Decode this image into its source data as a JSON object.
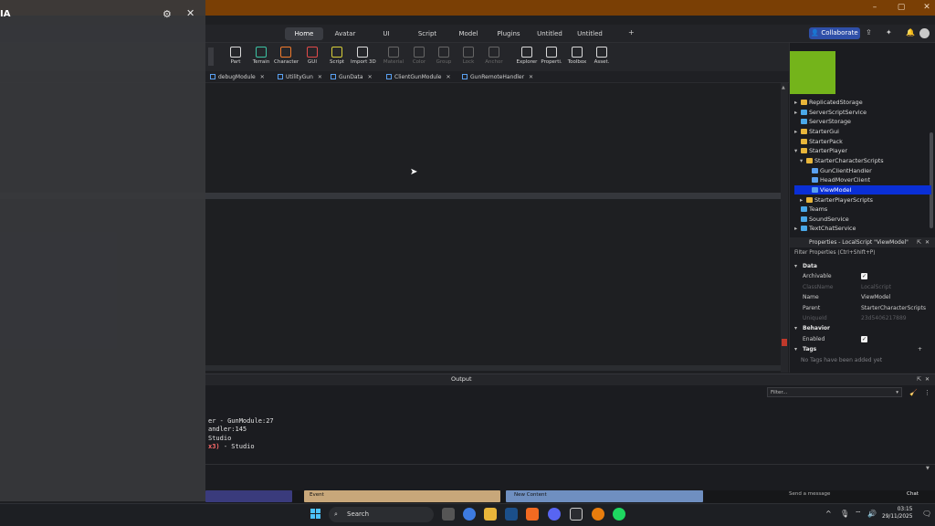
{
  "overlay": {
    "title": "IA",
    "settings_icon": "gear-icon",
    "close_icon": "close-icon"
  },
  "window": {
    "minimize": "–",
    "maximize": "▢",
    "close": "✕"
  },
  "menubar": {
    "tabs": [
      "Home",
      "Avatar",
      "UI",
      "Script",
      "Model",
      "Plugins",
      "Untitled",
      "Untitled"
    ],
    "active": "Home",
    "plus": "+",
    "collaborate": "Collaborate"
  },
  "toolbar": {
    "tools": [
      {
        "label": "Part",
        "icon": "part-cube-icon",
        "color": "#d9d9d9",
        "dim": false
      },
      {
        "label": "Terrain",
        "icon": "terrain-icon",
        "color": "#3cc3a3",
        "dim": false
      },
      {
        "label": "Character",
        "icon": "character-icon",
        "color": "#f07a2c",
        "dim": false
      },
      {
        "label": "GUI",
        "icon": "gui-icon",
        "color": "#e04a4a",
        "dim": false
      },
      {
        "label": "Script",
        "icon": "script-icon",
        "color": "#d7cf3a",
        "dim": false
      },
      {
        "label": "Import 3D",
        "icon": "import-3d-icon",
        "color": "#d9d9d9",
        "dim": false
      },
      {
        "label": "Material",
        "icon": "material-icon",
        "color": "#666666",
        "dim": true
      },
      {
        "label": "Color",
        "icon": "color-icon",
        "color": "#666666",
        "dim": true
      },
      {
        "label": "Group",
        "icon": "group-icon",
        "color": "#666666",
        "dim": true
      },
      {
        "label": "Lock",
        "icon": "lock-icon",
        "color": "#666666",
        "dim": true
      },
      {
        "label": "Anchor",
        "icon": "anchor-icon",
        "color": "#666666",
        "dim": true
      },
      {
        "label": "Explorer",
        "icon": "explorer-icon",
        "color": "#d9d9d9",
        "dim": false
      },
      {
        "label": "Properti.",
        "icon": "properties-icon",
        "color": "#d9d9d9",
        "dim": false
      },
      {
        "label": "Toolbox",
        "icon": "toolbox-icon",
        "color": "#d9d9d9",
        "dim": false
      },
      {
        "label": "Asset.",
        "icon": "asset-icon",
        "color": "#d9d9d9",
        "dim": false
      }
    ]
  },
  "script_tabs": [
    "debugModule",
    "UtilityGun",
    "GunData",
    "ClientGunModule",
    "GunRemoteHandler"
  ],
  "explorer": {
    "items": [
      {
        "label": "ReplicatedStorage",
        "indent": 0,
        "arrow": "▸",
        "icon_color": "#e8b53a",
        "selected": false
      },
      {
        "label": "ServerScriptService",
        "indent": 0,
        "arrow": "▸",
        "icon_color": "#4aa8e8",
        "selected": false
      },
      {
        "label": "ServerStorage",
        "indent": 0,
        "arrow": "",
        "icon_color": "#4aa8e8",
        "selected": false
      },
      {
        "label": "StarterGui",
        "indent": 0,
        "arrow": "▸",
        "icon_color": "#e8b53a",
        "selected": false
      },
      {
        "label": "StarterPack",
        "indent": 0,
        "arrow": "",
        "icon_color": "#e8b53a",
        "selected": false
      },
      {
        "label": "StarterPlayer",
        "indent": 0,
        "arrow": "▾",
        "icon_color": "#e8b53a",
        "selected": false
      },
      {
        "label": "StarterCharacterScripts",
        "indent": 1,
        "arrow": "▾",
        "icon_color": "#e8b53a",
        "selected": false
      },
      {
        "label": "GunClientHandler",
        "indent": 2,
        "arrow": "",
        "icon_color": "#5aa0f0",
        "selected": false
      },
      {
        "label": "HeadMoverClient",
        "indent": 2,
        "arrow": "",
        "icon_color": "#5aa0f0",
        "selected": false
      },
      {
        "label": "ViewModel",
        "indent": 2,
        "arrow": "",
        "icon_color": "#5aa0f0",
        "selected": true
      },
      {
        "label": "StarterPlayerScripts",
        "indent": 1,
        "arrow": "▸",
        "icon_color": "#e8b53a",
        "selected": false
      },
      {
        "label": "Teams",
        "indent": 0,
        "arrow": "",
        "icon_color": "#4aa8e8",
        "selected": false
      },
      {
        "label": "SoundService",
        "indent": 0,
        "arrow": "",
        "icon_color": "#4aa8e8",
        "selected": false
      },
      {
        "label": "TextChatService",
        "indent": 0,
        "arrow": "▸",
        "icon_color": "#4aa8e8",
        "selected": false
      }
    ]
  },
  "properties": {
    "header": "Properties - LocalScript \"ViewModel\"",
    "filter_placeholder": "Filter Properties (Ctrl+Shift+P)",
    "rows": [
      {
        "type": "section",
        "key": "Data"
      },
      {
        "type": "check",
        "key": "Archivable",
        "checked": true
      },
      {
        "type": "value",
        "key": "ClassName",
        "value": "LocalScript",
        "dim": true
      },
      {
        "type": "value",
        "key": "Name",
        "value": "ViewModel",
        "dim": false
      },
      {
        "type": "value",
        "key": "Parent",
        "value": "StarterCharacterScripts",
        "dim": false
      },
      {
        "type": "value",
        "key": "UniqueId",
        "value": "23d5406217889",
        "dim": true
      },
      {
        "type": "section",
        "key": "Behavior"
      },
      {
        "type": "check",
        "key": "Enabled",
        "checked": true
      },
      {
        "type": "section",
        "key": "Tags"
      },
      {
        "type": "note",
        "key": "No Tags have been added yet"
      }
    ]
  },
  "output": {
    "title": "Output",
    "filter_placeholder": "Filter...",
    "lines": [
      {
        "text": "er - GunModule:27",
        "color": "#e3e3e3"
      },
      {
        "text": "andler:145",
        "color": "#e3e3e3"
      },
      {
        "text": "Studio",
        "color": "#e3e3e3"
      },
      {
        "text": "x3)  -  Studio",
        "color": "#e3e3e3",
        "accent": "x3)"
      }
    ]
  },
  "bottom_strip": {
    "event_label": "Event",
    "new_content_label": "New Content",
    "send_message": "Send a message",
    "chat_label": "Chat"
  },
  "taskbar": {
    "search_label": "Search",
    "time": "03:15",
    "date": "29/11/2025"
  }
}
